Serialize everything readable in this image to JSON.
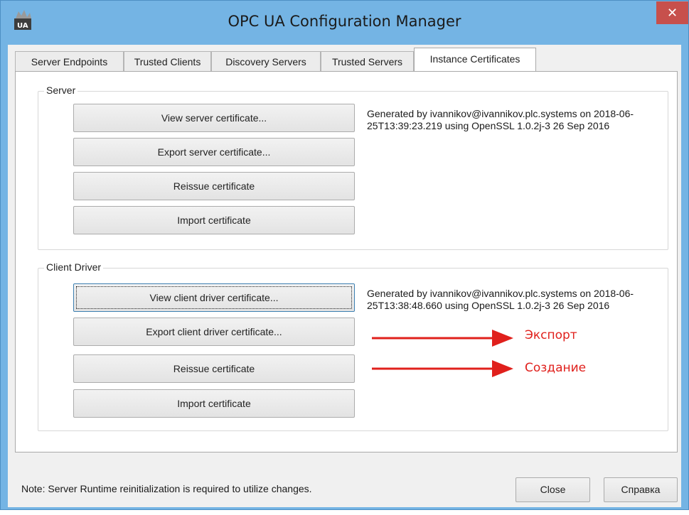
{
  "window": {
    "title": "OPC UA Configuration Manager",
    "close_glyph": "✕"
  },
  "tabs": [
    {
      "label": "Server Endpoints",
      "active": false
    },
    {
      "label": "Trusted Clients",
      "active": false
    },
    {
      "label": "Discovery Servers",
      "active": false
    },
    {
      "label": "Trusted Servers",
      "active": false
    },
    {
      "label": "Instance Certificates",
      "active": true
    }
  ],
  "server_group": {
    "label": "Server",
    "buttons": {
      "view": "View server certificate...",
      "export": "Export server certificate...",
      "reissue": "Reissue certificate",
      "import": "Import certificate"
    },
    "info": "Generated by ivannikov@ivannikov.plc.systems on 2018-06-25T13:39:23.219 using OpenSSL 1.0.2j-3  26 Sep 2016"
  },
  "client_group": {
    "label": "Client Driver",
    "buttons": {
      "view": "View client driver certificate...",
      "export": "Export client driver certificate...",
      "reissue": "Reissue certificate",
      "import": "Import certificate"
    },
    "info": "Generated by ivannikov@ivannikov.plc.systems on 2018-06-25T13:38:48.660 using OpenSSL 1.0.2j-3  26 Sep 2016"
  },
  "annotations": {
    "export": "Экспорт",
    "create": "Создание",
    "color": "#e0201c"
  },
  "footer": {
    "note": "Note: Server Runtime reinitialization is required to utilize changes.",
    "close_label": "Close",
    "help_label": "Справка"
  },
  "colors": {
    "frame": "#74b4e4",
    "close_button": "#c7504c"
  }
}
